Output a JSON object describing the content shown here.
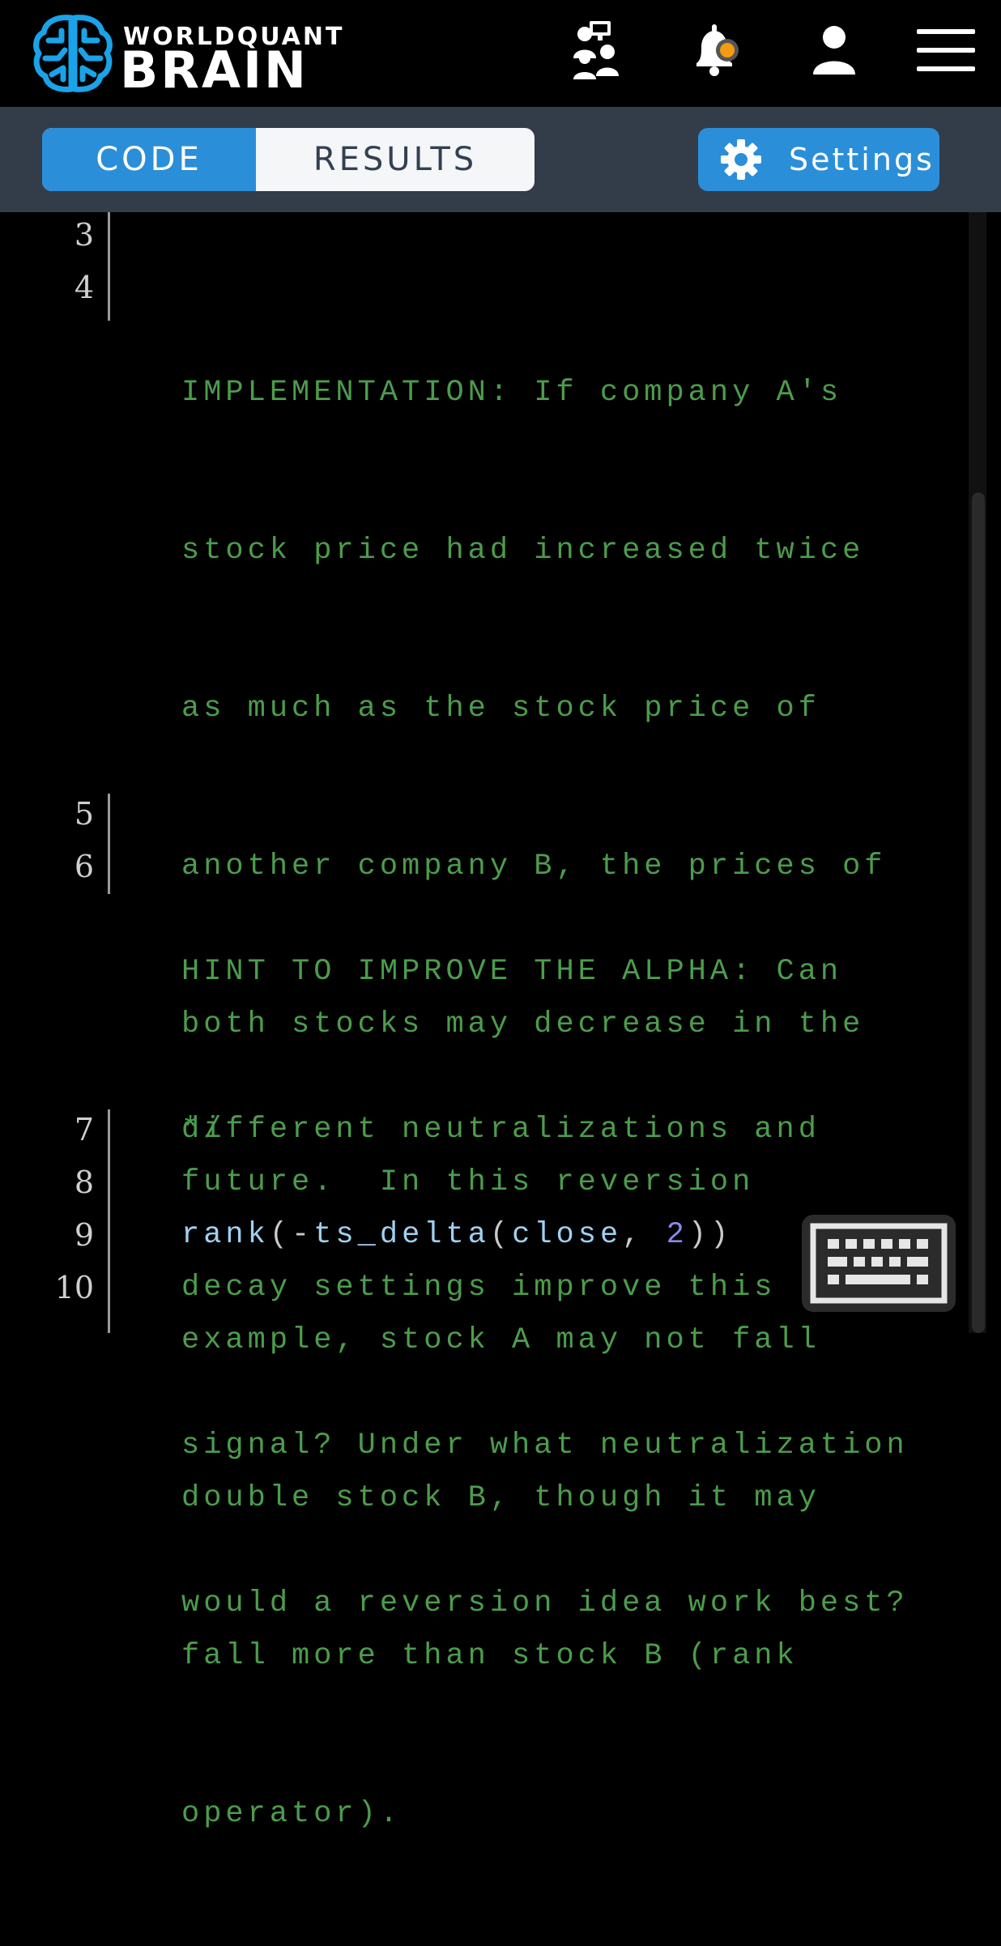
{
  "header": {
    "logo_top": "WORLDQUANT",
    "logo_bottom": "BRAIN",
    "icons": [
      "team-icon",
      "notification-bell-icon",
      "user-icon",
      "menu-icon"
    ],
    "notification_dot_color": "#f39c12"
  },
  "toolbar": {
    "tabs": [
      {
        "label": "CODE",
        "active": true
      },
      {
        "label": "RESULTS",
        "active": false
      }
    ],
    "settings_label": "Settings"
  },
  "editor": {
    "line_numbers": [
      "3",
      "4",
      "5",
      "6",
      "7",
      "8",
      "9",
      "10"
    ],
    "comment_4": [
      "IMPLEMENTATION: If company A's",
      "stock price had increased twice",
      "as much as the stock price of",
      "another company B, the prices of",
      "both stocks may decrease in the",
      "future.  In this reversion",
      "example, stock A may not fall",
      "double stock B, though it may",
      "fall more than stock B (rank",
      "operator)."
    ],
    "comment_6": [
      "HINT TO IMPROVE THE ALPHA: Can",
      "different neutralizations and",
      "decay settings improve this",
      "signal? Under what neutralization",
      "would a reversion idea work best?"
    ],
    "comment_end": "*/",
    "code_line": {
      "fn": "rank",
      "open1": "(",
      "minus": "-",
      "fn2": "ts_delta",
      "open2": "(",
      "arg": "close",
      "comma": ", ",
      "num": "2",
      "close": "))"
    }
  },
  "colors": {
    "accent": "#2b8ed8",
    "comment": "#4c9c4c",
    "toolbar_bg": "#333c49"
  }
}
